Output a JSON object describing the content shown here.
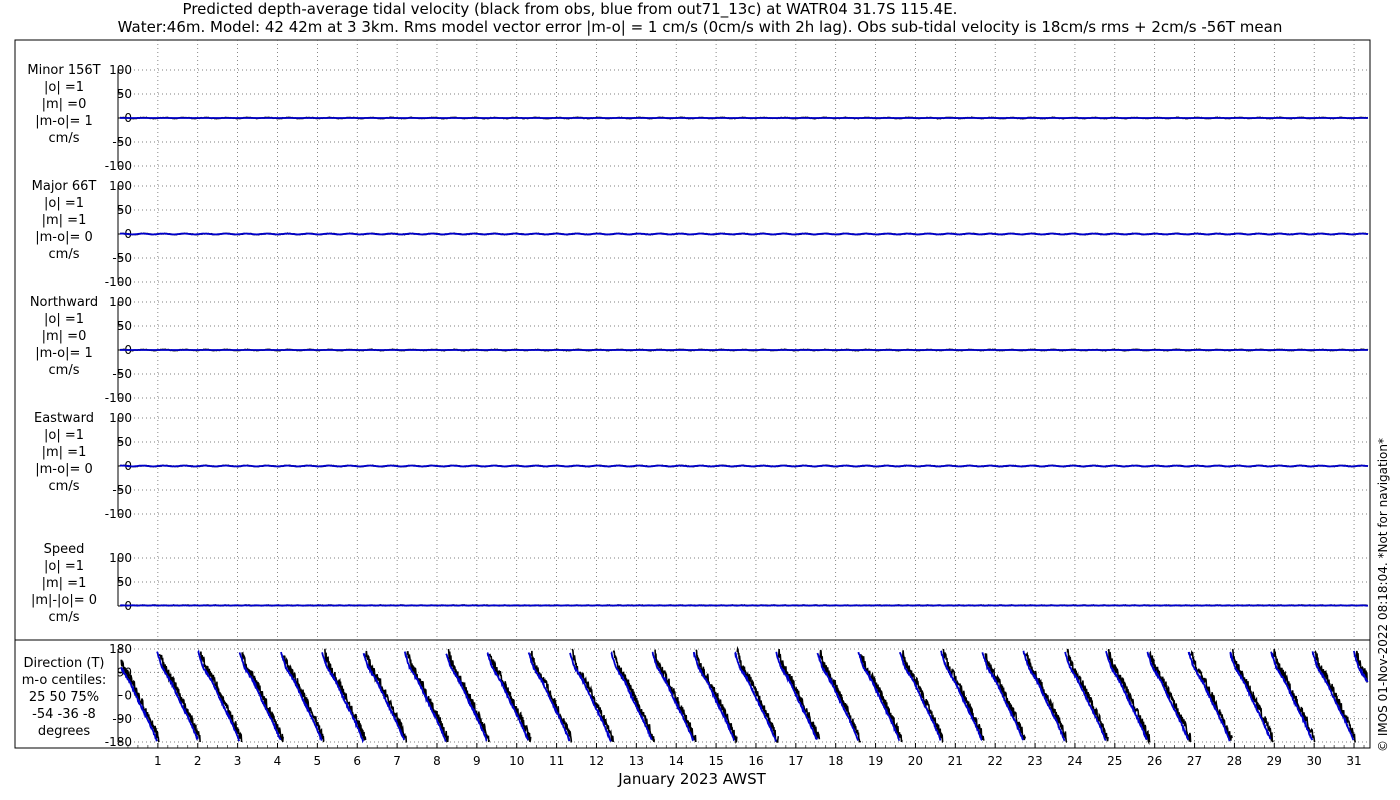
{
  "title_line1": "Predicted depth-average tidal velocity (black from obs, blue from out71_13c) at WATR04 31.7S 115.4E.",
  "title_line2": "Water:46m. Model: 42 42m at 3 3km. Rms model vector error |m-o| = 1 cm/s (0cm/s with 2h lag). Obs sub-tidal velocity is 18cm/s rms + 2cm/s -56T mean",
  "side_note": "© IMOS 01-Nov-2022 08:18:04. *Not for navigation*",
  "xlabel": "January 2023 AWST",
  "colors": {
    "obs": "#000000",
    "model": "#0000cc",
    "grid": "#555555"
  },
  "chart_data": {
    "type": "line",
    "x": {
      "unit": "day of January 2023",
      "range": [
        0,
        31.4
      ],
      "ticks": [
        1,
        2,
        3,
        4,
        5,
        6,
        7,
        8,
        9,
        10,
        11,
        12,
        13,
        14,
        15,
        16,
        17,
        18,
        19,
        20,
        21,
        22,
        23,
        24,
        25,
        26,
        27,
        28,
        29,
        30,
        31
      ]
    },
    "series_legend": [
      "black from obs",
      "blue from out71_13c"
    ],
    "panels": [
      {
        "id": "minor",
        "label_lines": [
          "Minor 156T",
          "|o| =1",
          "|m| =0",
          "|m-o|= 1",
          "cm/s"
        ],
        "ylim": [
          -100,
          100
        ],
        "yticks": [
          -100,
          -50,
          0,
          50,
          100
        ],
        "obs_amp": 1,
        "model_amp": 0
      },
      {
        "id": "major",
        "label_lines": [
          "Major 66T",
          "|o| =1",
          "|m| =1",
          "|m-o|= 0",
          "cm/s"
        ],
        "ylim": [
          -100,
          100
        ],
        "yticks": [
          -100,
          -50,
          0,
          50,
          100
        ],
        "obs_amp": 1,
        "model_amp": 1
      },
      {
        "id": "northward",
        "label_lines": [
          "Northward",
          "|o| =1",
          "|m| =0",
          "|m-o|= 1",
          "cm/s"
        ],
        "ylim": [
          -100,
          100
        ],
        "yticks": [
          -100,
          -50,
          0,
          50,
          100
        ],
        "obs_amp": 1,
        "model_amp": 0
      },
      {
        "id": "eastward",
        "label_lines": [
          "Eastward",
          "|o| =1",
          "|m| =1",
          "|m-o|= 0",
          "cm/s"
        ],
        "ylim": [
          -100,
          100
        ],
        "yticks": [
          -100,
          -50,
          0,
          50,
          100
        ],
        "obs_amp": 1,
        "model_amp": 1
      },
      {
        "id": "speed",
        "label_lines": [
          "Speed",
          "|o| =1",
          "|m| =1",
          "|m|-|o|= 0",
          "cm/s"
        ],
        "ylim": [
          0,
          100
        ],
        "yticks": [
          0,
          50,
          100
        ],
        "obs_amp": 1,
        "model_amp": 1
      },
      {
        "id": "direction",
        "label_lines": [
          "Direction (T)",
          "m-o centiles:",
          "25  50  75%",
          "-54 -36  -8",
          "degrees"
        ],
        "ylim": [
          -180,
          180
        ],
        "yticks": [
          -180,
          -90,
          0,
          90,
          180
        ],
        "period_days": 1.035
      }
    ]
  }
}
